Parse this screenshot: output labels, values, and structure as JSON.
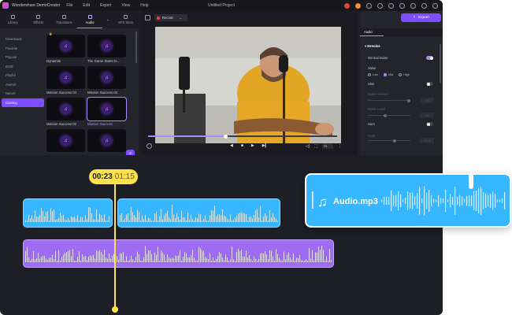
{
  "app": {
    "name": "Wondershare DemoCreator",
    "project_title": "Untitled Project",
    "menu": [
      "File",
      "Edit",
      "Export",
      "View",
      "Help"
    ]
  },
  "left_panel": {
    "tabs": [
      "Library",
      "Effects",
      "Transitions",
      "Audio",
      "SFX Store"
    ],
    "active_tab": "Audio",
    "categories": [
      "Downloads",
      "Favorite",
      "Popular",
      "BGM",
      "Playful",
      "Animal",
      "Nature",
      "Gaming"
    ],
    "active_category": "Gaming",
    "items": [
      {
        "name": "Dynamite",
        "premium": true
      },
      {
        "name": "The Game Starts N..."
      },
      {
        "name": "Mission Success 04"
      },
      {
        "name": "Mission Success 03"
      },
      {
        "name": "Mission Success 02"
      },
      {
        "name": "Mission Success",
        "selected": true
      },
      {
        "name": ""
      },
      {
        "name": ""
      }
    ]
  },
  "preview": {
    "record_label": "Record",
    "timecode": "00:00:09 | 00:00:22",
    "progress_fraction": 0.41,
    "fit_label": "Fit"
  },
  "right_panel": {
    "export_label": "Export",
    "tab_label": "Audio",
    "section_title": "Denoise",
    "normal_noise_label": "Normal Noise",
    "value_label": "Value",
    "radio_options": [
      "Low",
      "Mid",
      "High"
    ],
    "radio_selected": "Mid",
    "hiss_label": "Hiss",
    "noise_volume_label": "Noise Volume",
    "noise_volume_value": "0.00",
    "noise_level_label": "Noise Level",
    "noise_level_value": "0.00",
    "hum_label": "Hum",
    "gate_label": "Gate",
    "gate_value": "-25.00"
  },
  "timeline": {
    "playhead_current": "00:23",
    "playhead_total": "01:15",
    "audio_card_name": "Audio.mp3"
  },
  "colors": {
    "accent_purple": "#7d4dff",
    "clip_blue": "#36b7ff",
    "clip_purple": "#9d6cf2",
    "playhead_yellow": "#ffe24a"
  }
}
